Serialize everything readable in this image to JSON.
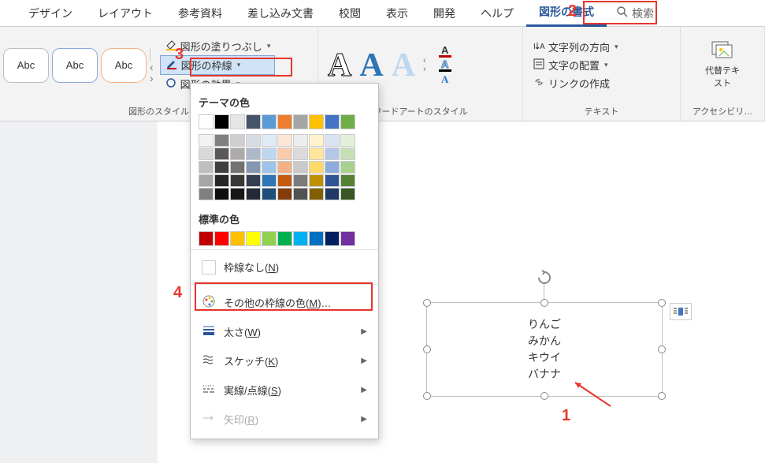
{
  "tabs": {
    "design": "デザイン",
    "layout": "レイアウト",
    "references": "参考資料",
    "mailings": "差し込み文書",
    "review": "校閲",
    "view": "表示",
    "developer": "開発",
    "help": "ヘルプ",
    "shape_format": "図形の書式"
  },
  "search": {
    "label": "検索"
  },
  "ribbon": {
    "shape_styles": {
      "label": "図形のスタイル",
      "sample": "Abc",
      "fill": "図形の塗りつぶし",
      "outline": "図形の枠線",
      "effects": "図形の効果"
    },
    "wordart": {
      "label": "ワードアートのスタイル"
    },
    "text": {
      "label": "テキスト",
      "direction": "文字列の方向",
      "align": "文字の配置",
      "link": "リンクの作成"
    },
    "acc": {
      "label": "アクセシビリ…",
      "alt": "代替テキスト"
    }
  },
  "dropdown": {
    "theme_title": "テーマの色",
    "standard_title": "標準の色",
    "no_outline": "枠線なし(",
    "no_outline_key": "N",
    "more_colors": "その他の枠線の色(",
    "more_colors_key": "M",
    "more_colors_suffix": ")…",
    "weight": "太さ(",
    "weight_key": "W",
    "sketch": "スケッチ(",
    "sketch_key": "K",
    "dashes": "実線/点線(",
    "dashes_key": "S",
    "arrows": "矢印(",
    "arrows_key": "R",
    "close_paren": ")",
    "theme_row1": [
      "#ffffff",
      "#000000",
      "#e7e6e6",
      "#44546a",
      "#5b9bd5",
      "#ed7d31",
      "#a5a5a5",
      "#ffc000",
      "#4472c4",
      "#70ad47"
    ],
    "theme_shades": [
      [
        "#f2f2f2",
        "#d9d9d9",
        "#bfbfbf",
        "#a6a6a6",
        "#808080"
      ],
      [
        "#808080",
        "#595959",
        "#404040",
        "#262626",
        "#0d0d0d"
      ],
      [
        "#d0cece",
        "#aeaaaa",
        "#757171",
        "#3b3838",
        "#181717"
      ],
      [
        "#d6dce5",
        "#adb9ca",
        "#8497b0",
        "#333f50",
        "#222a35"
      ],
      [
        "#deebf7",
        "#bdd7ee",
        "#9dc3e7",
        "#2e75b6",
        "#1f4e79"
      ],
      [
        "#fbe5d6",
        "#f8cbad",
        "#f4b183",
        "#c55a11",
        "#843c0c"
      ],
      [
        "#ededed",
        "#dbdbdb",
        "#c9c9c9",
        "#7b7b7b",
        "#525252"
      ],
      [
        "#fff2cc",
        "#ffe699",
        "#ffd966",
        "#bf9000",
        "#806000"
      ],
      [
        "#dae3f3",
        "#b4c7e7",
        "#8faadc",
        "#2f5597",
        "#203864"
      ],
      [
        "#e2f0d9",
        "#c5e0b4",
        "#a9d18e",
        "#548235",
        "#385723"
      ]
    ],
    "standard_colors": [
      "#c00000",
      "#ff0000",
      "#ffc000",
      "#ffff00",
      "#92d050",
      "#00b050",
      "#00b0f0",
      "#0070c0",
      "#002060",
      "#7030a0"
    ]
  },
  "textbox": {
    "lines": [
      "りんご",
      "みかん",
      "キウイ",
      "バナナ"
    ]
  },
  "annotations": {
    "n1": "1",
    "n2": "2",
    "n3": "3",
    "n4": "4"
  },
  "chart_data": {
    "type": "table",
    "title": "",
    "categories": [],
    "values": []
  }
}
